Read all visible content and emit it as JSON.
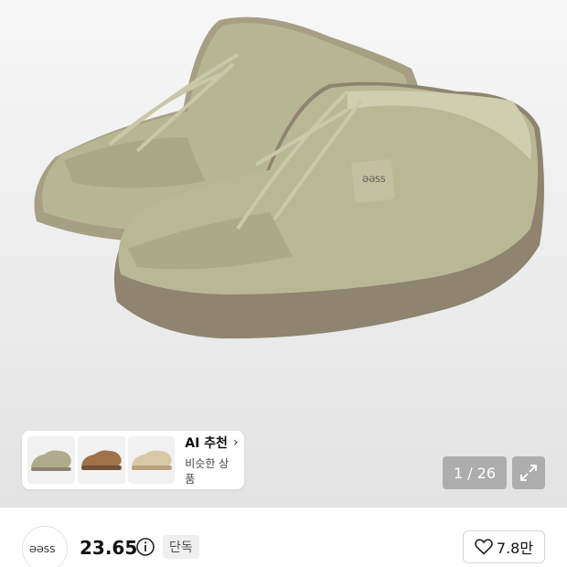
{
  "product": {
    "image_alt": "suede moccasin shoes pair",
    "image_counter": "1 / 26"
  },
  "ai_recommend": {
    "title": "AI 추천",
    "subtitle": "비슷한 상품",
    "thumbnails": [
      "khaki-suede-shoe",
      "brown-leather-shoe",
      "beige-boat-shoe"
    ]
  },
  "info": {
    "brand_logo_text": "ƏƏSS",
    "size": "23.65",
    "badge": "단독",
    "likes": "7.8만"
  },
  "colors": {
    "shoe": "#b6b592",
    "sole": "#8b7f6a",
    "counter_bg": "#8a8a8a"
  }
}
